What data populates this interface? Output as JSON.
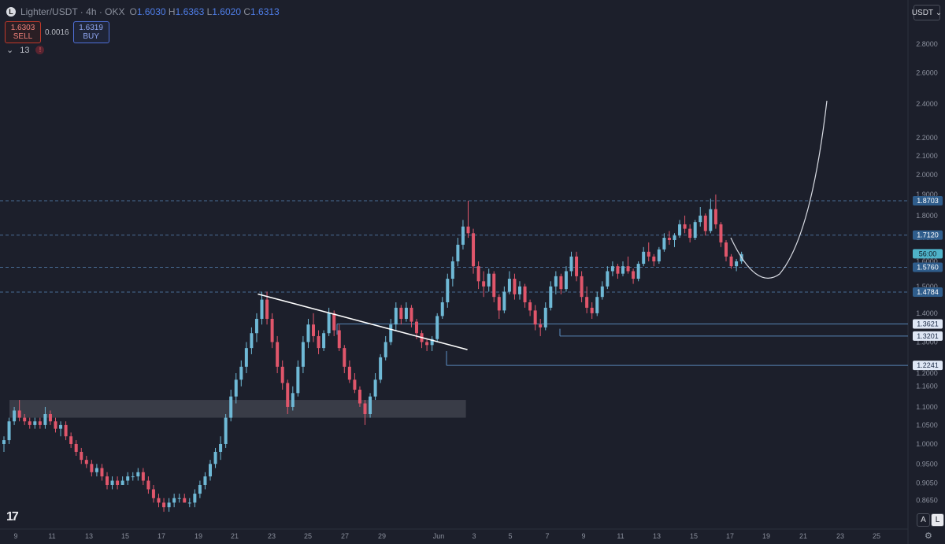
{
  "header": {
    "symbol": "Lighter/USDT · 4h · OKX",
    "open_label": "O",
    "open": "1.6030",
    "high_label": "H",
    "high": "1.6363",
    "low_label": "L",
    "low": "1.6020",
    "close_label": "C",
    "close": "1.6313"
  },
  "trade": {
    "sell_price": "1.6303",
    "sell_label": "SELL",
    "spread": "0.0016",
    "buy_price": "1.6319",
    "buy_label": "BUY"
  },
  "indicator": {
    "count": "13",
    "warning": "!"
  },
  "currency": "USDT",
  "bottom": {
    "auto_label": "A",
    "log_label": "L",
    "logo_text": "17"
  },
  "colors": {
    "background": "#1c1f2b",
    "up": "#6fb9d6",
    "down": "#e0566b",
    "level_line": "#5c8fc4",
    "trend_line": "#ffffff",
    "zone": "#5d606b"
  },
  "chart_data": {
    "type": "candlestick",
    "timeframe": "4h",
    "y_scale": "log",
    "ylim": [
      0.81,
      2.95
    ],
    "y_ticks": [
      2.8,
      2.6,
      2.4,
      2.2,
      2.1,
      2.0,
      1.9,
      1.8,
      1.7,
      1.6,
      1.5,
      1.4,
      1.3,
      1.2,
      1.16,
      1.1,
      1.05,
      1.0,
      0.95,
      0.905,
      0.865
    ],
    "y_tick_labels": [
      "2.8000",
      "2.6000",
      "2.4000",
      "2.2000",
      "2.1000",
      "2.0000",
      "1.9000",
      "1.8000",
      "1.7000",
      "1.6000",
      "1.5000",
      "1.4000",
      "1.3000",
      "1.2000",
      "1.1600",
      "1.1000",
      "1.0500",
      "1.0000",
      "0.9500",
      "0.9050",
      "0.8650"
    ],
    "x_ticks": [
      "9",
      "11",
      "13",
      "15",
      "17",
      "19",
      "21",
      "23",
      "25",
      "27",
      "29",
      "Jun",
      "3",
      "5",
      "7",
      "9",
      "11",
      "13",
      "15",
      "17",
      "19",
      "21",
      "23",
      "25"
    ],
    "price_levels": [
      {
        "label": "1.8703",
        "value": 1.8703,
        "style": "dashed"
      },
      {
        "label": "1.7120",
        "value": 1.712,
        "style": "dashed"
      },
      {
        "label": "1.5760",
        "value": 1.576,
        "style": "dashed"
      },
      {
        "label": "1.4784",
        "value": 1.4784,
        "style": "dashed"
      },
      {
        "label": "1.3621",
        "value": 1.3621,
        "style": "solid"
      },
      {
        "label": "1.3201",
        "value": 1.3201,
        "style": "solid"
      },
      {
        "label": "1.2241",
        "value": 1.2241,
        "style": "solid"
      }
    ],
    "countdown_label": "56:00",
    "last_price": 1.6313,
    "candles": [
      [
        1.0,
        1.02,
        0.98,
        1.01
      ],
      [
        1.01,
        1.07,
        1.0,
        1.06
      ],
      [
        1.06,
        1.1,
        1.05,
        1.09
      ],
      [
        1.09,
        1.12,
        1.06,
        1.07
      ],
      [
        1.07,
        1.08,
        1.05,
        1.06
      ],
      [
        1.06,
        1.07,
        1.04,
        1.05
      ],
      [
        1.05,
        1.07,
        1.04,
        1.06
      ],
      [
        1.06,
        1.07,
        1.04,
        1.05
      ],
      [
        1.05,
        1.1,
        1.04,
        1.08
      ],
      [
        1.08,
        1.09,
        1.05,
        1.06
      ],
      [
        1.06,
        1.07,
        1.03,
        1.04
      ],
      [
        1.04,
        1.06,
        1.02,
        1.05
      ],
      [
        1.05,
        1.06,
        1.01,
        1.02
      ],
      [
        1.02,
        1.03,
        0.99,
        1.0
      ],
      [
        1.0,
        1.01,
        0.97,
        0.98
      ],
      [
        0.98,
        0.99,
        0.95,
        0.96
      ],
      [
        0.96,
        0.97,
        0.94,
        0.95
      ],
      [
        0.95,
        0.96,
        0.92,
        0.93
      ],
      [
        0.93,
        0.95,
        0.92,
        0.94
      ],
      [
        0.94,
        0.95,
        0.91,
        0.92
      ],
      [
        0.92,
        0.93,
        0.89,
        0.9
      ],
      [
        0.9,
        0.92,
        0.89,
        0.91
      ],
      [
        0.91,
        0.92,
        0.89,
        0.9
      ],
      [
        0.9,
        0.92,
        0.9,
        0.91
      ],
      [
        0.91,
        0.93,
        0.9,
        0.92
      ],
      [
        0.92,
        0.93,
        0.91,
        0.92
      ],
      [
        0.92,
        0.94,
        0.91,
        0.93
      ],
      [
        0.93,
        0.94,
        0.9,
        0.91
      ],
      [
        0.91,
        0.92,
        0.88,
        0.89
      ],
      [
        0.89,
        0.9,
        0.86,
        0.87
      ],
      [
        0.87,
        0.88,
        0.85,
        0.86
      ],
      [
        0.86,
        0.87,
        0.84,
        0.85
      ],
      [
        0.85,
        0.87,
        0.84,
        0.86
      ],
      [
        0.86,
        0.88,
        0.85,
        0.87
      ],
      [
        0.87,
        0.88,
        0.86,
        0.87
      ],
      [
        0.87,
        0.88,
        0.86,
        0.86
      ],
      [
        0.86,
        0.87,
        0.85,
        0.86
      ],
      [
        0.86,
        0.89,
        0.85,
        0.88
      ],
      [
        0.88,
        0.91,
        0.87,
        0.9
      ],
      [
        0.9,
        0.93,
        0.89,
        0.92
      ],
      [
        0.92,
        0.96,
        0.91,
        0.95
      ],
      [
        0.95,
        0.99,
        0.94,
        0.98
      ],
      [
        0.98,
        1.02,
        0.96,
        1.0
      ],
      [
        1.0,
        1.08,
        0.99,
        1.07
      ],
      [
        1.07,
        1.15,
        1.06,
        1.13
      ],
      [
        1.13,
        1.2,
        1.11,
        1.18
      ],
      [
        1.18,
        1.24,
        1.16,
        1.22
      ],
      [
        1.22,
        1.3,
        1.2,
        1.28
      ],
      [
        1.28,
        1.35,
        1.26,
        1.33
      ],
      [
        1.33,
        1.4,
        1.3,
        1.38
      ],
      [
        1.38,
        1.48,
        1.36,
        1.45
      ],
      [
        1.45,
        1.48,
        1.36,
        1.38
      ],
      [
        1.38,
        1.4,
        1.28,
        1.3
      ],
      [
        1.3,
        1.32,
        1.2,
        1.22
      ],
      [
        1.22,
        1.24,
        1.15,
        1.17
      ],
      [
        1.17,
        1.18,
        1.08,
        1.1
      ],
      [
        1.1,
        1.16,
        1.09,
        1.14
      ],
      [
        1.14,
        1.24,
        1.13,
        1.22
      ],
      [
        1.22,
        1.32,
        1.2,
        1.3
      ],
      [
        1.3,
        1.38,
        1.28,
        1.36
      ],
      [
        1.36,
        1.4,
        1.3,
        1.32
      ],
      [
        1.32,
        1.34,
        1.26,
        1.28
      ],
      [
        1.28,
        1.34,
        1.27,
        1.33
      ],
      [
        1.33,
        1.42,
        1.32,
        1.4
      ],
      [
        1.4,
        1.41,
        1.32,
        1.34
      ],
      [
        1.34,
        1.36,
        1.27,
        1.28
      ],
      [
        1.28,
        1.29,
        1.2,
        1.22
      ],
      [
        1.22,
        1.24,
        1.17,
        1.18
      ],
      [
        1.18,
        1.2,
        1.14,
        1.15
      ],
      [
        1.15,
        1.16,
        1.1,
        1.11
      ],
      [
        1.11,
        1.12,
        1.05,
        1.08
      ],
      [
        1.08,
        1.14,
        1.07,
        1.13
      ],
      [
        1.13,
        1.2,
        1.12,
        1.18
      ],
      [
        1.18,
        1.26,
        1.17,
        1.25
      ],
      [
        1.25,
        1.32,
        1.24,
        1.3
      ],
      [
        1.3,
        1.38,
        1.29,
        1.36
      ],
      [
        1.36,
        1.44,
        1.34,
        1.42
      ],
      [
        1.42,
        1.43,
        1.36,
        1.38
      ],
      [
        1.38,
        1.44,
        1.37,
        1.42
      ],
      [
        1.42,
        1.43,
        1.35,
        1.37
      ],
      [
        1.37,
        1.38,
        1.31,
        1.33
      ],
      [
        1.33,
        1.34,
        1.28,
        1.3
      ],
      [
        1.3,
        1.31,
        1.27,
        1.29
      ],
      [
        1.29,
        1.32,
        1.27,
        1.31
      ],
      [
        1.31,
        1.4,
        1.3,
        1.39
      ],
      [
        1.39,
        1.46,
        1.38,
        1.44
      ],
      [
        1.44,
        1.55,
        1.42,
        1.53
      ],
      [
        1.53,
        1.62,
        1.5,
        1.6
      ],
      [
        1.6,
        1.7,
        1.58,
        1.67
      ],
      [
        1.67,
        1.78,
        1.65,
        1.75
      ],
      [
        1.75,
        1.87,
        1.7,
        1.72
      ],
      [
        1.72,
        1.74,
        1.55,
        1.58
      ],
      [
        1.58,
        1.6,
        1.49,
        1.52
      ],
      [
        1.52,
        1.56,
        1.46,
        1.5
      ],
      [
        1.5,
        1.57,
        1.48,
        1.55
      ],
      [
        1.55,
        1.56,
        1.44,
        1.46
      ],
      [
        1.46,
        1.47,
        1.38,
        1.41
      ],
      [
        1.41,
        1.5,
        1.4,
        1.48
      ],
      [
        1.48,
        1.56,
        1.47,
        1.53
      ],
      [
        1.53,
        1.55,
        1.45,
        1.47
      ],
      [
        1.47,
        1.52,
        1.45,
        1.5
      ],
      [
        1.5,
        1.51,
        1.42,
        1.44
      ],
      [
        1.44,
        1.45,
        1.39,
        1.41
      ],
      [
        1.41,
        1.43,
        1.34,
        1.36
      ],
      [
        1.36,
        1.38,
        1.32,
        1.35
      ],
      [
        1.35,
        1.44,
        1.34,
        1.42
      ],
      [
        1.42,
        1.52,
        1.41,
        1.5
      ],
      [
        1.5,
        1.56,
        1.47,
        1.54
      ],
      [
        1.54,
        1.55,
        1.47,
        1.49
      ],
      [
        1.49,
        1.58,
        1.48,
        1.56
      ],
      [
        1.56,
        1.64,
        1.54,
        1.62
      ],
      [
        1.62,
        1.64,
        1.52,
        1.54
      ],
      [
        1.54,
        1.56,
        1.44,
        1.46
      ],
      [
        1.46,
        1.5,
        1.4,
        1.42
      ],
      [
        1.42,
        1.44,
        1.38,
        1.4
      ],
      [
        1.4,
        1.48,
        1.39,
        1.46
      ],
      [
        1.46,
        1.52,
        1.45,
        1.5
      ],
      [
        1.5,
        1.58,
        1.49,
        1.56
      ],
      [
        1.56,
        1.6,
        1.54,
        1.58
      ],
      [
        1.58,
        1.59,
        1.53,
        1.55
      ],
      [
        1.55,
        1.6,
        1.54,
        1.58
      ],
      [
        1.58,
        1.62,
        1.55,
        1.56
      ],
      [
        1.56,
        1.57,
        1.51,
        1.53
      ],
      [
        1.53,
        1.6,
        1.52,
        1.59
      ],
      [
        1.59,
        1.66,
        1.58,
        1.64
      ],
      [
        1.64,
        1.68,
        1.6,
        1.62
      ],
      [
        1.62,
        1.63,
        1.58,
        1.6
      ],
      [
        1.6,
        1.66,
        1.59,
        1.65
      ],
      [
        1.65,
        1.72,
        1.64,
        1.7
      ],
      [
        1.7,
        1.73,
        1.67,
        1.69
      ],
      [
        1.69,
        1.72,
        1.66,
        1.71
      ],
      [
        1.71,
        1.78,
        1.7,
        1.76
      ],
      [
        1.76,
        1.8,
        1.72,
        1.74
      ],
      [
        1.74,
        1.76,
        1.68,
        1.7
      ],
      [
        1.7,
        1.78,
        1.69,
        1.77
      ],
      [
        1.77,
        1.84,
        1.75,
        1.8
      ],
      [
        1.8,
        1.81,
        1.71,
        1.73
      ],
      [
        1.73,
        1.88,
        1.72,
        1.83
      ],
      [
        1.83,
        1.9,
        1.74,
        1.76
      ],
      [
        1.76,
        1.77,
        1.66,
        1.68
      ],
      [
        1.68,
        1.69,
        1.6,
        1.62
      ],
      [
        1.62,
        1.63,
        1.57,
        1.58
      ],
      [
        1.58,
        1.61,
        1.56,
        1.6
      ],
      [
        1.6,
        1.64,
        1.59,
        1.63
      ]
    ],
    "zone": {
      "x_start_index": 0,
      "x_end_index": 72,
      "y_low": 1.07,
      "y_high": 1.12
    },
    "trendline": {
      "from": [
        39,
        1.48
      ],
      "to": [
        72,
        1.28
      ]
    },
    "projection_curve": "rounded bottom near 1.50 rising toward 2.40"
  }
}
